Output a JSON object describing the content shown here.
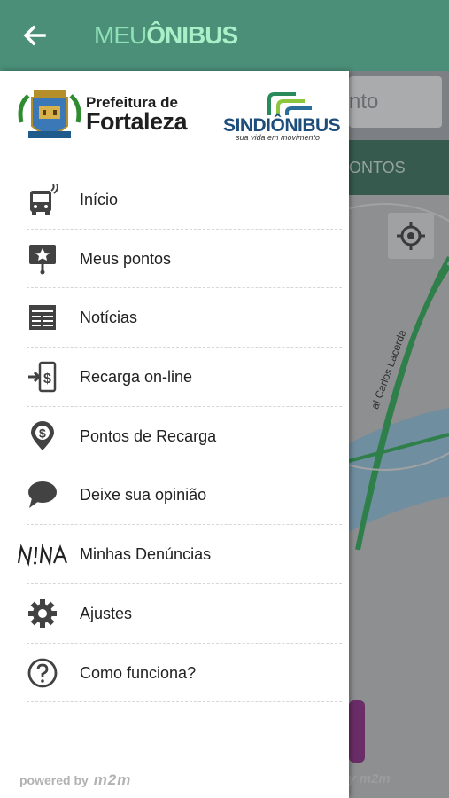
{
  "app": {
    "brand_light": "MEU",
    "brand_bold": "ÔNIBUS",
    "back_icon": "arrow-left-icon"
  },
  "logos": {
    "prefeitura_line1": "Prefeitura de",
    "prefeitura_line2": "Fortaleza",
    "sindionibus_name": "SINDIÔNIBUS",
    "sindionibus_tagline": "sua vida em movimento"
  },
  "menu": {
    "items": [
      {
        "label": "Início",
        "icon": "bus-icon"
      },
      {
        "label": "Meus pontos",
        "icon": "favorite-stop-icon"
      },
      {
        "label": "Notícias",
        "icon": "news-icon"
      },
      {
        "label": "Recarga on-line",
        "icon": "recharge-icon"
      },
      {
        "label": "Pontos de Recarga",
        "icon": "recharge-location-icon"
      },
      {
        "label": "Deixe sua opinião",
        "icon": "comment-icon"
      },
      {
        "label": "Minhas Denúncias",
        "icon": "nina-logo"
      },
      {
        "label": "Ajustes",
        "icon": "gear-icon"
      },
      {
        "label": "Como funciona?",
        "icon": "help-icon"
      }
    ]
  },
  "footer": {
    "powered_by": "powered by",
    "m2m": "m2m"
  },
  "background": {
    "search_fragment": "nto",
    "tab_fragment": "ONTOS",
    "street_label": "al Carlos Lacerda",
    "footer_fragment": "by",
    "footer_m2m": "m2m"
  },
  "colors": {
    "appbar": "#4b8f79",
    "brand_light": "#8ee0b6",
    "icon": "#424242",
    "text": "#212121"
  }
}
